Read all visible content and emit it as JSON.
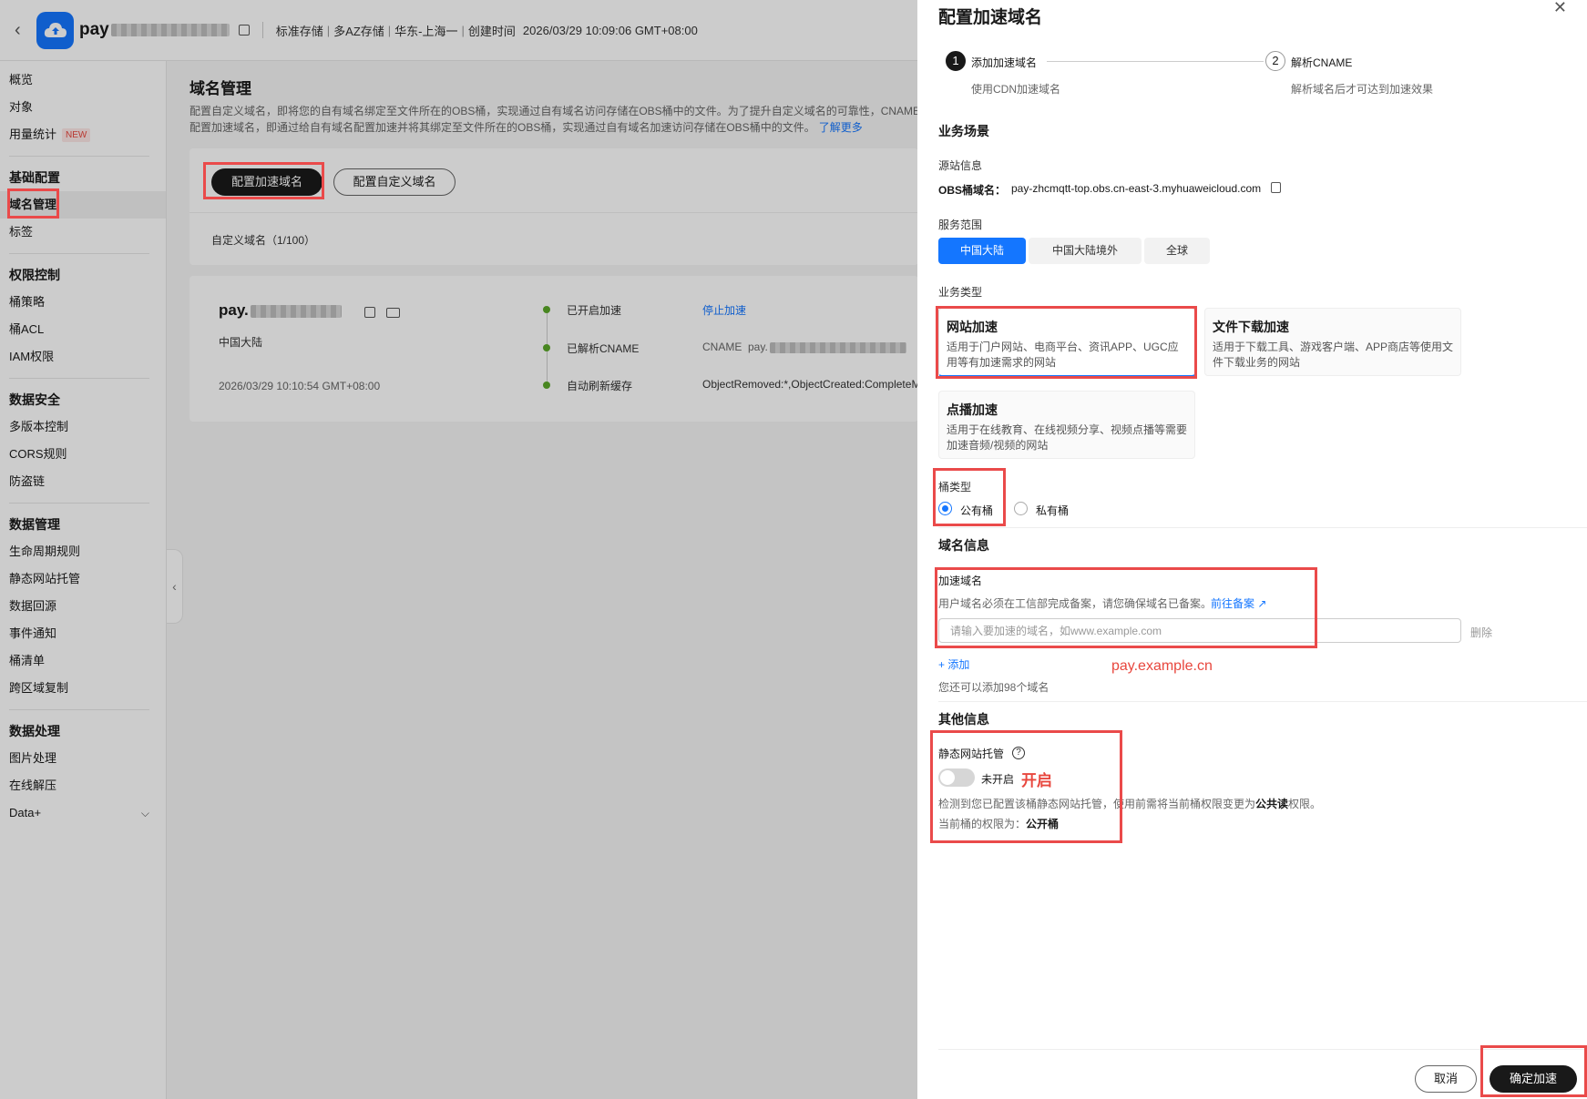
{
  "topbar": {
    "bucket_prefix": "pay",
    "storage_class": "标准存储",
    "redundancy": "多AZ存储",
    "region": "华东-上海一",
    "created_label": "创建时间",
    "created_time": "2026/03/29 10:09:06 GMT+08:00"
  },
  "sidebar": {
    "items_top": [
      {
        "label": "概览"
      },
      {
        "label": "对象"
      },
      {
        "label": "用量统计",
        "badge": "NEW"
      }
    ],
    "groups": [
      {
        "title": "基础配置",
        "items": [
          "域名管理",
          "标签"
        ]
      },
      {
        "title": "权限控制",
        "items": [
          "桶策略",
          "桶ACL",
          "IAM权限"
        ]
      },
      {
        "title": "数据安全",
        "items": [
          "多版本控制",
          "CORS规则",
          "防盗链"
        ]
      },
      {
        "title": "数据管理",
        "items": [
          "生命周期规则",
          "静态网站托管",
          "数据回源",
          "事件通知",
          "桶清单",
          "跨区域复制"
        ]
      },
      {
        "title": "数据处理",
        "items": [
          "图片处理",
          "在线解压",
          "Data+"
        ]
      }
    ],
    "active_item": "域名管理"
  },
  "main": {
    "title": "域名管理",
    "desc_line1": "配置自定义域名，即将您的自有域名绑定至文件所在的OBS桶，实现通过自有域名访问存储在OBS桶中的文件。为了提升自定义域名的可靠性，CNAME",
    "desc_line2": "配置加速域名，即通过给自有域名配置加速并将其绑定至文件所在的OBS桶，实现通过自有域名加速访问存储在OBS桶中的文件。",
    "learn_more": "了解更多",
    "btn_accel": "配置加速域名",
    "btn_custom": "配置自定义域名",
    "count_label": "自定义域名（1/100）",
    "domain_card": {
      "name_prefix": "pay.",
      "region": "中国大陆",
      "created": "2026/03/29 10:10:54 GMT+08:00",
      "statuses": [
        {
          "label": "已开启加速",
          "value": "停止加速"
        },
        {
          "label": "已解析CNAME",
          "value": "CNAME  pay."
        },
        {
          "label": "自动刷新缓存",
          "value": "ObjectRemoved:*,ObjectCreated:CompleteM"
        }
      ]
    }
  },
  "drawer": {
    "title": "配置加速域名",
    "steps": [
      {
        "num": "1",
        "title": "添加加速域名",
        "sub": "使用CDN加速域名"
      },
      {
        "num": "2",
        "title": "解析CNAME",
        "sub": "解析域名后才可达到加速效果"
      }
    ],
    "scenario_title": "业务场景",
    "origin_label": "源站信息",
    "obs_domain_label": "OBS桶域名：",
    "obs_domain": "pay-zhcmqtt-top.obs.cn-east-3.myhuaweicloud.com",
    "scope_label": "服务范围",
    "scope_options": [
      "中国大陆",
      "中国大陆境外",
      "全球"
    ],
    "scope_selected": "中国大陆",
    "type_label": "业务类型",
    "types": [
      {
        "title": "网站加速",
        "desc": "适用于门户网站、电商平台、资讯APP、UGC应用等有加速需求的网站"
      },
      {
        "title": "文件下载加速",
        "desc": "适用于下载工具、游戏客户端、APP商店等使用文件下载业务的网站"
      },
      {
        "title": "点播加速",
        "desc": "适用于在线教育、在线视频分享、视频点播等需要加速音频/视频的网站"
      }
    ],
    "bucket_type_label": "桶类型",
    "bucket_types": [
      "公有桶",
      "私有桶"
    ],
    "bucket_type_selected": "公有桶",
    "domain_info_title": "域名信息",
    "accel_domain_label": "加速域名",
    "icp_note": "用户域名必须在工信部完成备案，请您确保域名已备案。",
    "icp_link": "前往备案",
    "domain_placeholder": "请输入要加速的域名，如www.example.com",
    "delete_label": "删除",
    "add_label": "+ 添加",
    "remaining_note": "您还可以添加98个域名",
    "annotation_domain": "pay.example.cn",
    "other_title": "其他信息",
    "static_hosting_label": "静态网站托管",
    "toggle_state": "未开启",
    "annotation_toggle": "开启",
    "hosting_note_a": "检测到您已配置该桶静态网站托管，使用前需将当前桶权限变更为",
    "hosting_note_b": "公共读",
    "hosting_note_c": "权限。",
    "current_perm_label": "当前桶的权限为：",
    "current_perm_value": "公开桶",
    "cancel_label": "取消",
    "confirm_label": "确定加速"
  }
}
